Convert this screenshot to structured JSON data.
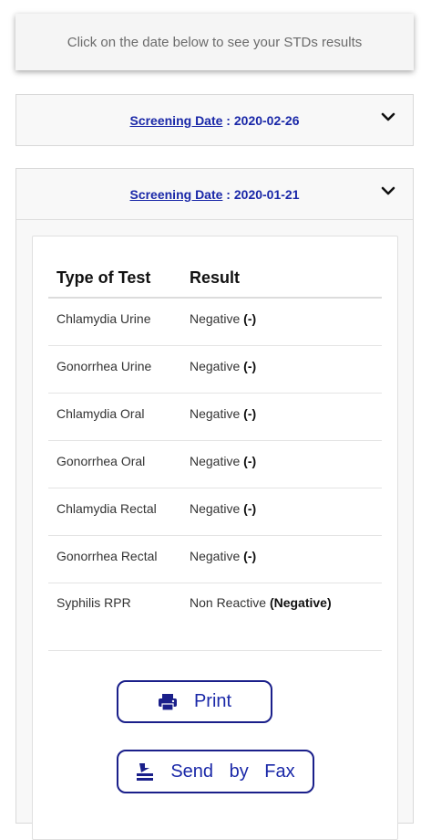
{
  "banner": {
    "text": "Click on the date below to see your STDs results"
  },
  "screenings": [
    {
      "label": "Screening Date",
      "separator": " : ",
      "date": "2020-02-26"
    },
    {
      "label": "Screening Date",
      "separator": " : ",
      "date": "2020-01-21"
    }
  ],
  "results": {
    "headers": [
      "Type of Test",
      "Result"
    ],
    "rows": [
      {
        "test": "Chlamydia Urine",
        "result": "Negative",
        "flag": "(-)"
      },
      {
        "test": "Gonorrhea Urine",
        "result": "Negative",
        "flag": "(-)"
      },
      {
        "test": "Chlamydia Oral",
        "result": "Negative",
        "flag": "(-)"
      },
      {
        "test": "Gonorrhea Oral",
        "result": "Negative",
        "flag": "(-)"
      },
      {
        "test": "Chlamydia Rectal",
        "result": "Negative",
        "flag": "(-)"
      },
      {
        "test": "Gonorrhea Rectal",
        "result": "Negative",
        "flag": "(-)"
      },
      {
        "test": "Syphilis RPR",
        "result": "Non Reactive",
        "flag": "(Negative)"
      }
    ]
  },
  "buttons": {
    "print_label": "Print",
    "print_icon": "printer-icon",
    "fax_label": "Send by Fax",
    "fax_icon": "fax-icon"
  },
  "colors": {
    "link": "#1a28a8",
    "button_border": "#1a1f8a"
  }
}
